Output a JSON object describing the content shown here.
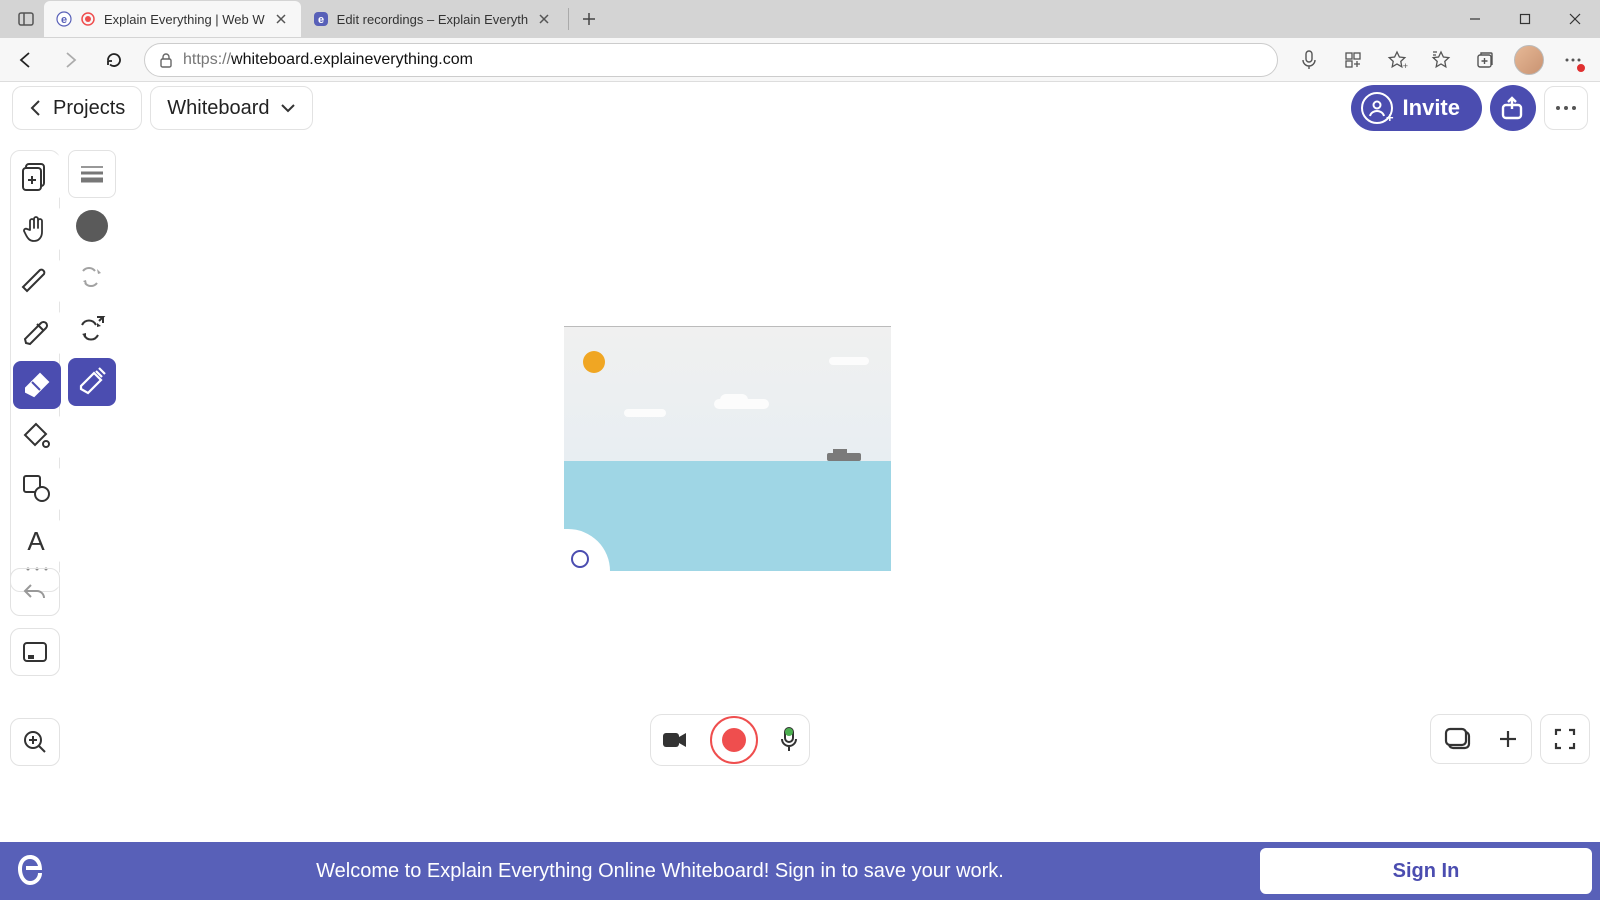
{
  "browser": {
    "tabs": [
      {
        "title": "Explain Everything | Web W",
        "active": true,
        "recording": true
      },
      {
        "title": "Edit recordings – Explain Everyth",
        "active": false,
        "recording": false
      }
    ],
    "url_scheme": "https://",
    "url_host": "whiteboard.explaineverything.com"
  },
  "header": {
    "projects_label": "Projects",
    "title": "Whiteboard",
    "invite_label": "Invite"
  },
  "tools": {
    "selected": "eraser",
    "subselected": "precise-eraser"
  },
  "banner": {
    "text": "Welcome to Explain Everything Online Whiteboard! Sign in to save your work.",
    "signin_label": "Sign In"
  },
  "colors": {
    "primary": "#4b4db0",
    "record": "#ef4e4e"
  }
}
